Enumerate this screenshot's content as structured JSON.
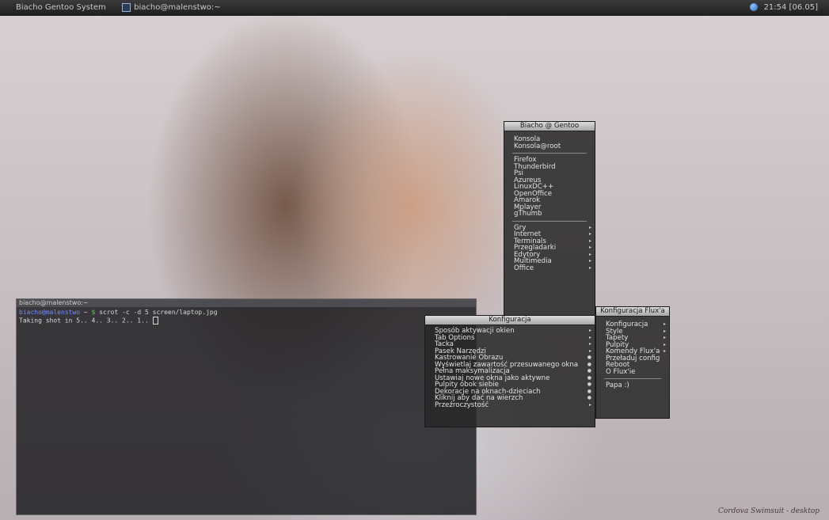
{
  "topbar": {
    "title": "Biacho Gentoo System",
    "terminal_label": "biacho@malenstwo:~",
    "clock": "21:54 [06.05]"
  },
  "terminal": {
    "title": "biacho@malenstwo:~",
    "prompt_user": "biacho@malenstwo",
    "prompt_path": "~",
    "prompt_symbol": "$",
    "command": "scrot -c -d 5 screen/laptop.jpg",
    "output": "Taking shot in 5.. 4.. 3.. 2.. 1.. "
  },
  "menu_main": {
    "title": "Biacho @ Gentoo",
    "group1": [
      "Konsola",
      "Konsola@root"
    ],
    "group2": [
      "Firefox",
      "Thunderbird",
      "Psi",
      "Azureus",
      "LinuxDC++",
      "OpenOffice",
      "Amarok",
      "Mplayer",
      "gThumb"
    ],
    "group3": [
      "Gry",
      "Internet",
      "Terminals",
      "Przegladarki",
      "Edytory",
      "Multimedia",
      "Office"
    ]
  },
  "menu_konfiguracja": {
    "title": "Konfiguracja",
    "items": [
      "Sposób aktywacji okien",
      "Tab Options",
      "Tacka",
      "Pasek Narzędzi",
      "Kastrowanie Obrazu",
      "Wyświetlaj zawartość przesuwanego okna",
      "Pełna maksymalizacja",
      "Ustawiaj nowe okna jako aktywne",
      "Pulpity obok siebie",
      "Dekoracje na oknach-dzieciach",
      "Kliknij aby dać na wierzch",
      "Przeźroczystość"
    ]
  },
  "menu_flux": {
    "title": "Konfiguracja Flux'a",
    "items": [
      "Konfiguracja",
      "Style",
      "Tapety",
      "Pulpity",
      "Komendy Flux'a",
      "Przeładuj config",
      "Reboot",
      "O Flux'ie"
    ],
    "exit": "Papa :)"
  },
  "watermark": "Cordova Swimsuit - desktop",
  "colors": {
    "menu_bg": "#282828",
    "menu_title_bg": "#c8c8c8",
    "terminal_bg": "#19191c",
    "prompt_user": "#6e8cff",
    "prompt_symbol": "#57c957"
  }
}
